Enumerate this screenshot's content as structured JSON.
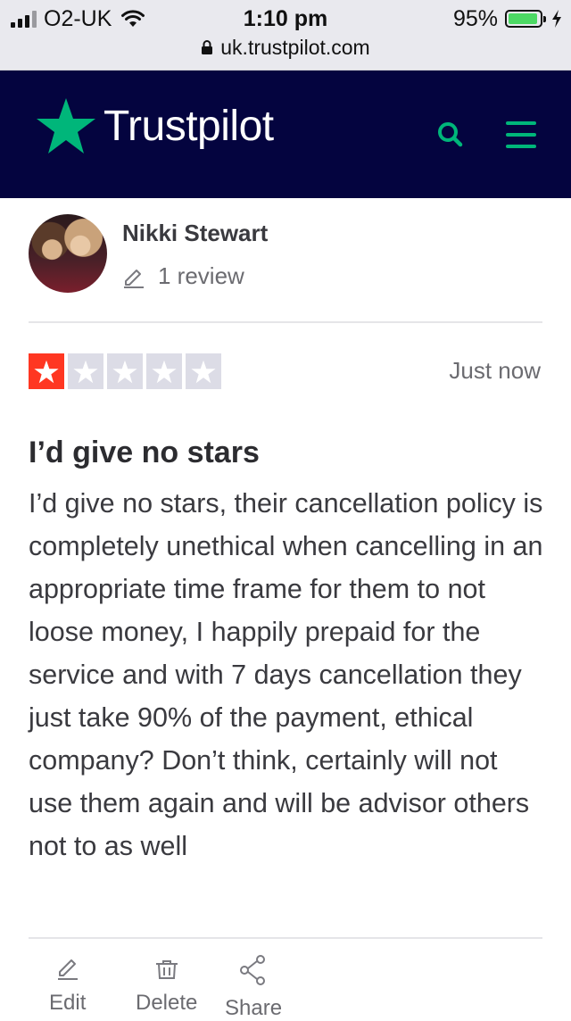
{
  "status_bar": {
    "carrier": "O2-UK",
    "time": "1:10 pm",
    "battery_percent": "95%",
    "battery_level": 0.95,
    "signal_bars_filled": 3,
    "signal_bars_total": 4,
    "url": "uk.trustpilot.com",
    "icons": [
      "signal-icon",
      "wifi-icon",
      "battery-icon",
      "charging-bolt-icon",
      "lock-icon"
    ]
  },
  "header": {
    "brand": "Trustpilot",
    "brand_color": "#04043f",
    "accent_color": "#00b67a",
    "icons": [
      "trustpilot-star-logo",
      "search-icon",
      "hamburger-menu-icon"
    ]
  },
  "reviewer": {
    "name": "Nikki Stewart",
    "review_count": "1 review"
  },
  "review": {
    "rating": 1,
    "rating_max": 5,
    "star_color": "#ff3722",
    "date": "Just now",
    "title": "I’d give no stars",
    "body": "I’d give no stars, their cancellation policy is completely unethical when cancelling in an appropriate time frame for them to not loose money, I happily prepaid for the service and with 7 days cancellation they just take 90% of the payment, ethical company? Don’t think, certainly will not use them again and will be advisor others not to as well"
  },
  "actions": {
    "edit": "Edit",
    "delete": "Delete",
    "share": "Share"
  }
}
